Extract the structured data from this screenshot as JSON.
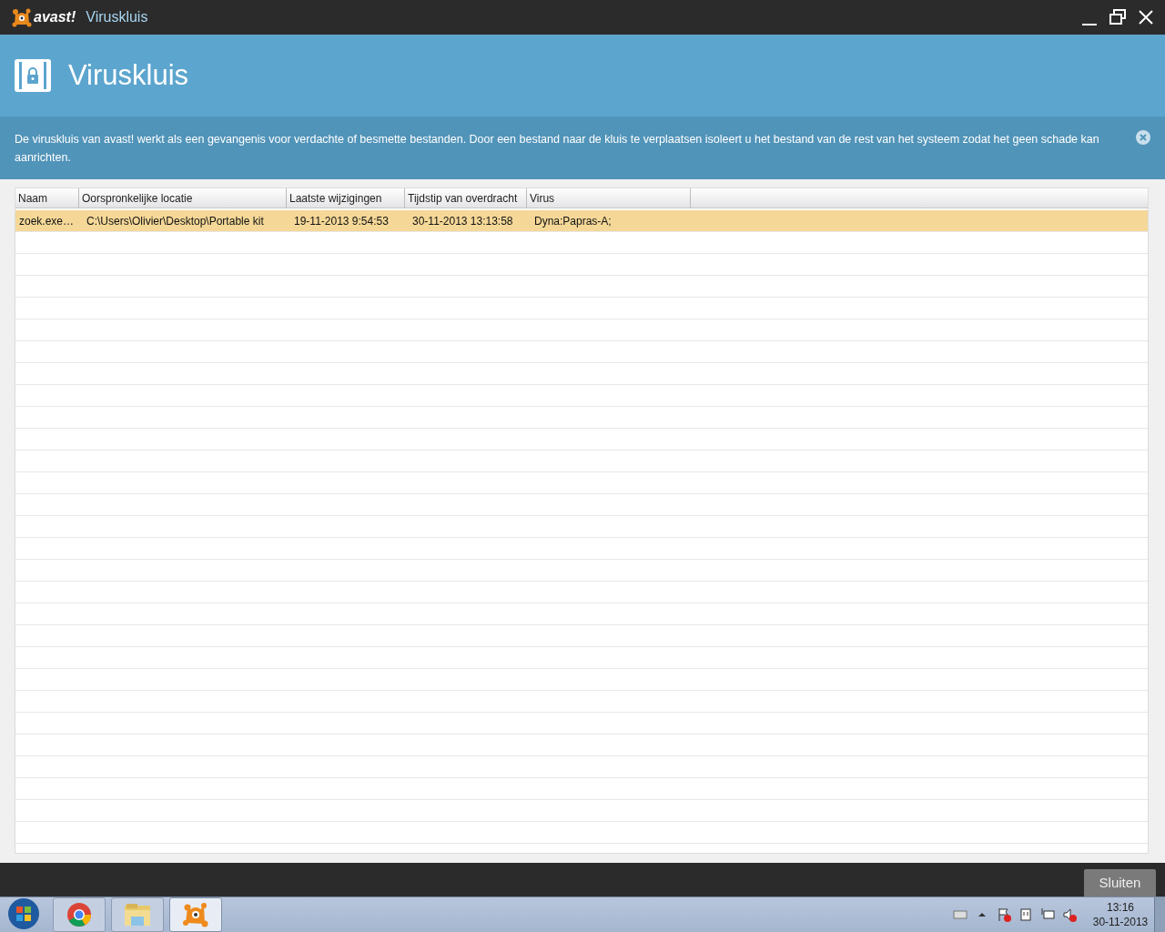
{
  "window": {
    "logo": "avast!",
    "title": "Viruskluis"
  },
  "header": {
    "title": "Viruskluis"
  },
  "info": {
    "text": "De viruskluis van avast! werkt als een gevangenis voor verdachte of besmette bestanden. Door een bestand naar de kluis te verplaatsen isoleert u het bestand van de rest van het systeem zodat het geen schade kan aanrichten."
  },
  "table": {
    "columns": [
      "Naam",
      "Oorspronkelijke locatie",
      "Laatste wijzigingen",
      "Tijdstip van overdracht",
      "Virus"
    ],
    "rows": [
      {
        "selected": true,
        "cells": [
          "zoek.exe…",
          "C:\\Users\\Olivier\\Desktop\\Portable kit",
          "19-11-2013 9:54:53",
          "30-11-2013 13:13:58",
          "Dyna:Papras-A;"
        ]
      }
    ]
  },
  "footer": {
    "button": "Sluiten"
  },
  "taskbar": {
    "items": [
      {
        "kind": "chrome",
        "selected": false
      },
      {
        "kind": "folder",
        "selected": false
      },
      {
        "kind": "avast",
        "selected": true
      }
    ],
    "clock": {
      "time": "13:16",
      "date": "30-11-2013"
    }
  }
}
